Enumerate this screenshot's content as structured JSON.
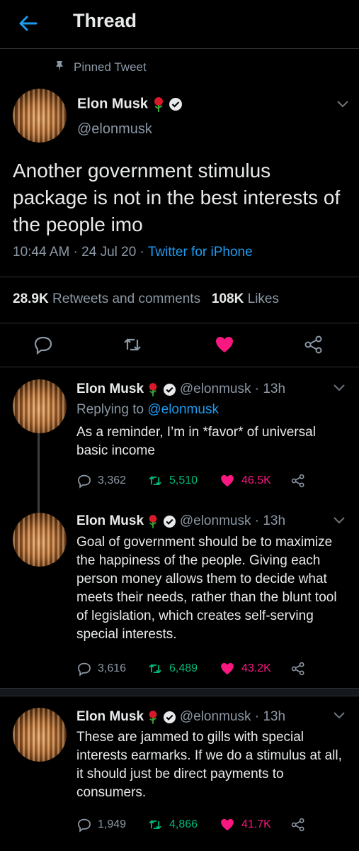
{
  "header": {
    "title": "Thread"
  },
  "pinned": {
    "label": "Pinned Tweet"
  },
  "main_tweet": {
    "name": "Elon Musk",
    "handle": "@elonmusk",
    "text": "Another government stimulus package is not in the best interests of the people imo",
    "time": "10:44 AM · 24 Jul 20 · ",
    "source": "Twitter for iPhone",
    "retweets_count": "28.9K",
    "retweets_label": "Retweets and comments",
    "likes_count": "108K",
    "likes_label": "Likes"
  },
  "replies": [
    {
      "name": "Elon Musk",
      "handle_time": "@elonmusk · 13h",
      "replying_prefix": "Replying to ",
      "replying_handle": "@elonmusk",
      "text": "As a reminder, I’m in *favor* of universal basic income",
      "comments": "3,362",
      "retweets": "5,510",
      "likes": "46.5K"
    },
    {
      "name": "Elon Musk",
      "handle_time": "@elonmusk · 13h",
      "text": "Goal of government should be to maximize the happiness of the people. Giving each person money allows them to decide what meets their needs, rather than the blunt tool of legislation, which creates self-serving special interests.",
      "comments": "3,616",
      "retweets": "6,489",
      "likes": "43.2K"
    },
    {
      "name": "Elon Musk",
      "handle_time": "@elonmusk · 13h",
      "text": "These are jammed to gills with special interests earmarks. If we do a stimulus at all, it should just be direct payments to consumers.",
      "comments": "1,949",
      "retweets": "4,866",
      "likes": "41.7K"
    }
  ],
  "colors": {
    "accent": "#1d9bf0",
    "like": "#f91880",
    "retweet": "#00ba7c",
    "muted": "#8b98a5"
  }
}
